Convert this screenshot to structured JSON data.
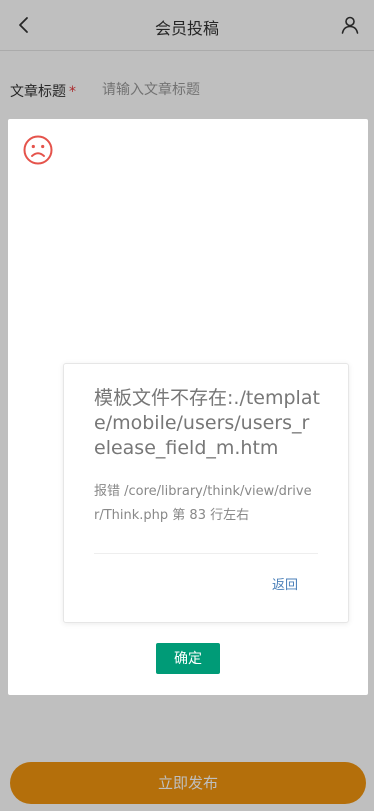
{
  "header": {
    "title": "会员投稿"
  },
  "form": {
    "title_label": "文章标题",
    "required_mark": "*",
    "title_placeholder": "请输入文章标题"
  },
  "publish_button_label": "立即发布",
  "error_dialog": {
    "title": "模板文件不存在:./template/mobile/users/users_release_field_m.htm",
    "detail": "报错 /core/library/think/view/driver/Think.php 第 83 行左右",
    "return_label": "返回",
    "confirm_label": "确定"
  },
  "colors": {
    "publish_button": "#f0950f",
    "confirm_button": "#009b77",
    "sad_icon": "#e5534b",
    "return_link": "#4a7fb8",
    "required_mark": "#e4393c"
  },
  "icons": {
    "back": "chevron-left-icon",
    "user": "user-icon",
    "sad": "sad-face-icon"
  }
}
